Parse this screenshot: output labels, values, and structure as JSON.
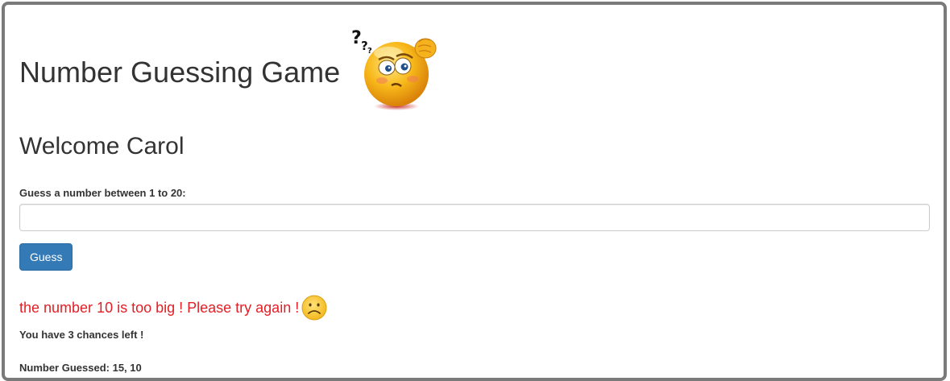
{
  "header": {
    "title": "Number Guessing Game",
    "icon": "thinking-face-icon"
  },
  "welcome": "Welcome Carol",
  "form": {
    "label": "Guess a number between 1 to 20:",
    "input_value": "",
    "button_label": "Guess"
  },
  "result": {
    "message": "the number 10 is too big ! Please try again !",
    "icon": "sad-face-icon",
    "chances": "You have 3 chances left !",
    "guessed": "Number Guessed: 15, 10"
  },
  "colors": {
    "primary_button": "#337ab7",
    "error_text": "#e31e24",
    "frame_border": "#7a7a7a"
  }
}
